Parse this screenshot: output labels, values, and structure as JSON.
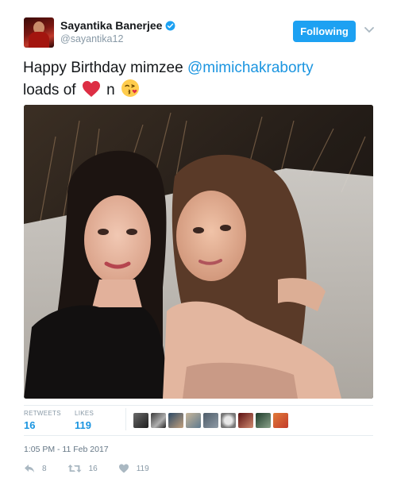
{
  "user": {
    "display_name": "Sayantika Banerjee",
    "handle": "@sayantika12",
    "verified": true
  },
  "follow_button": {
    "label": "Following"
  },
  "tweet": {
    "text_part1": "Happy Birthday mimzee ",
    "mention": "@mimichakraborty",
    "text_part2": "loads of ",
    "text_part3": " n ",
    "emojis": [
      "red-heart",
      "face-blowing-kiss"
    ]
  },
  "stats": {
    "retweets_label": "RETWEETS",
    "retweets_value": "16",
    "likes_label": "LIKES",
    "likes_value": "119",
    "liker_avatar_count": 9
  },
  "timestamp": "1:05 PM - 11 Feb 2017",
  "actions": {
    "reply_count": "8",
    "retweet_count": "16",
    "like_count": "119"
  },
  "colors": {
    "accent": "#1da1f2",
    "link": "#1b95e0",
    "muted": "#8899a6",
    "heart": "#e0245e"
  }
}
